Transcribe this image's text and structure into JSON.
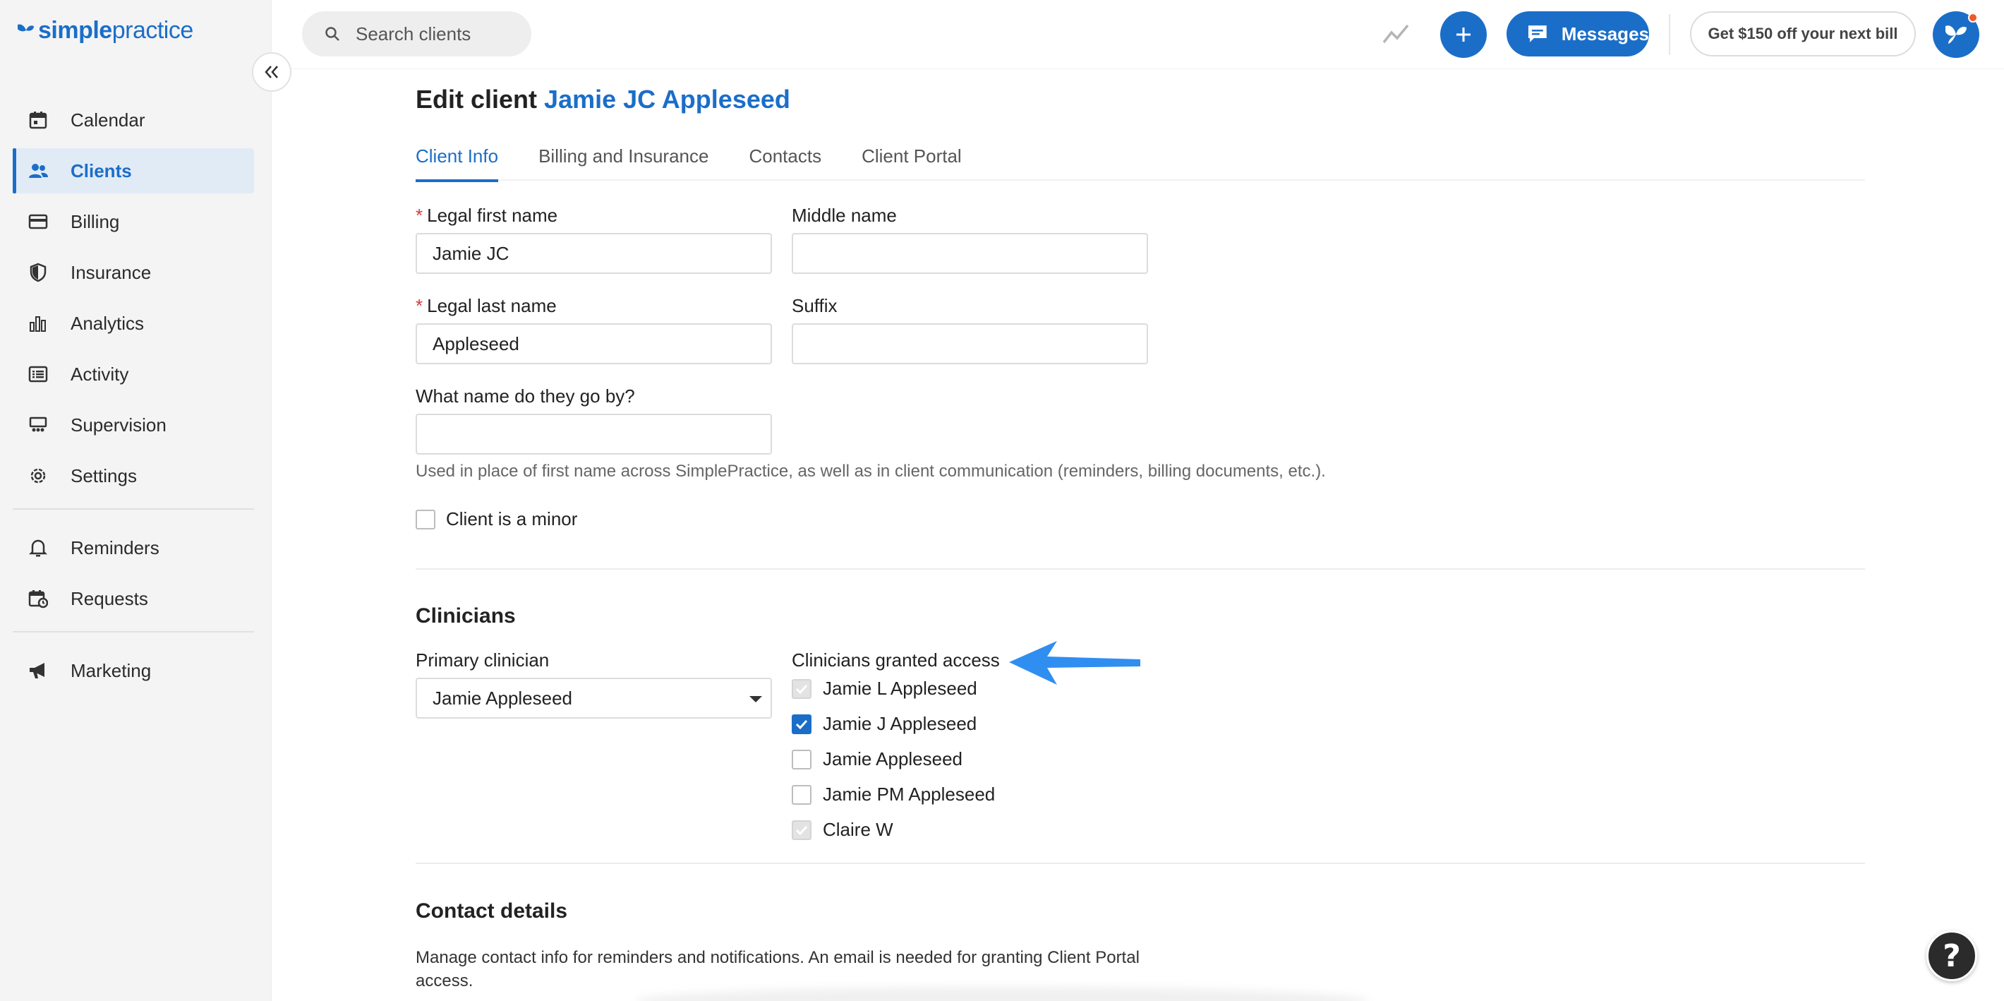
{
  "brand": {
    "logo_bold": "simple",
    "logo_light": "practice"
  },
  "sidebar": {
    "items": [
      {
        "label": "Calendar",
        "icon": "calendar-icon",
        "active": false
      },
      {
        "label": "Clients",
        "icon": "users-icon",
        "active": true
      },
      {
        "label": "Billing",
        "icon": "credit-card-icon",
        "active": false
      },
      {
        "label": "Insurance",
        "icon": "shield-icon",
        "active": false
      },
      {
        "label": "Analytics",
        "icon": "bar-chart-icon",
        "active": false
      },
      {
        "label": "Activity",
        "icon": "list-icon",
        "active": false
      },
      {
        "label": "Supervision",
        "icon": "supervision-icon",
        "active": false
      },
      {
        "label": "Settings",
        "icon": "gear-icon",
        "active": false
      },
      {
        "label": "Reminders",
        "icon": "bell-icon",
        "active": false
      },
      {
        "label": "Requests",
        "icon": "calendar-request-icon",
        "active": false
      },
      {
        "label": "Marketing",
        "icon": "megaphone-icon",
        "active": false
      }
    ]
  },
  "topbar": {
    "search_placeholder": "Search clients",
    "messages_label": "Messages",
    "promo_label": "Get $150 off your next bill"
  },
  "page": {
    "title_prefix": "Edit client",
    "client_name": "Jamie JC Appleseed",
    "tabs": [
      "Client Info",
      "Billing and Insurance",
      "Contacts",
      "Client Portal"
    ],
    "active_tab": "Client Info"
  },
  "form": {
    "legal_first_name_label": "Legal first name",
    "legal_first_name_value": "Jamie JC",
    "middle_name_label": "Middle name",
    "middle_name_value": "",
    "legal_last_name_label": "Legal last name",
    "legal_last_name_value": "Appleseed",
    "suffix_label": "Suffix",
    "suffix_value": "",
    "preferred_name_label": "What name do they go by?",
    "preferred_name_value": "",
    "preferred_name_help": "Used in place of first name across SimplePractice, as well as in client communication (reminders, billing documents, etc.).",
    "minor_label": "Client is a minor",
    "minor_checked": false,
    "required_mark": "*"
  },
  "clinicians": {
    "section_title": "Clinicians",
    "primary_label": "Primary clinician",
    "primary_value": "Jamie Appleseed",
    "granted_label": "Clinicians granted access",
    "granted": [
      {
        "name": "Jamie L Appleseed",
        "state": "disabled"
      },
      {
        "name": "Jamie J Appleseed",
        "state": "checked"
      },
      {
        "name": "Jamie Appleseed",
        "state": "unchecked"
      },
      {
        "name": "Jamie PM Appleseed",
        "state": "unchecked"
      },
      {
        "name": "Claire W",
        "state": "disabled"
      }
    ]
  },
  "contact_details": {
    "section_title": "Contact details",
    "description": "Manage contact info for reminders and notifications. An email is needed for granting Client Portal access."
  },
  "help_fab_label": "?",
  "colors": {
    "brand": "#1b6ec8",
    "annotation_arrow": "#2f8ef0"
  }
}
